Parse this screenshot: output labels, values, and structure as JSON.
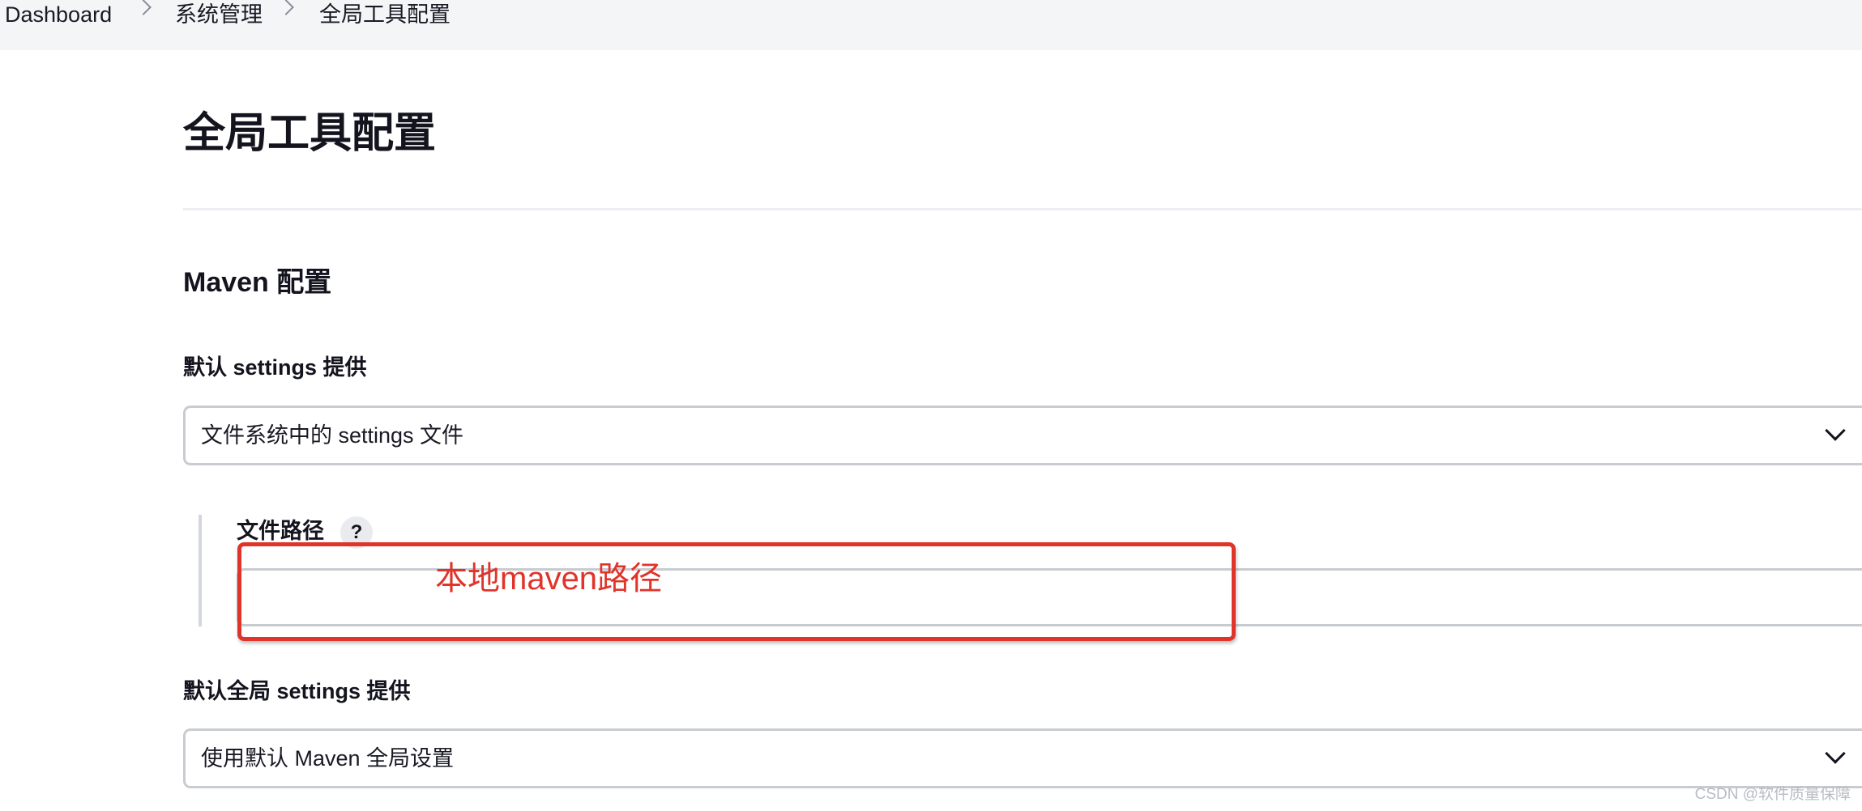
{
  "breadcrumb": {
    "items": [
      "Dashboard",
      "系统管理",
      "全局工具配置"
    ]
  },
  "page": {
    "title": "全局工具配置"
  },
  "maven_section": {
    "title": "Maven 配置",
    "default_settings": {
      "label": "默认 settings 提供",
      "selected": "文件系统中的 settings 文件",
      "file_path": {
        "label": "文件路径",
        "help": "?",
        "value": ""
      }
    },
    "default_global_settings": {
      "label": "默认全局 settings 提供",
      "selected": "使用默认 Maven 全局设置"
    }
  },
  "annotation": {
    "text": "本地maven路径",
    "color": "#e0342a"
  },
  "watermark": "CSDN @软件质量保障"
}
